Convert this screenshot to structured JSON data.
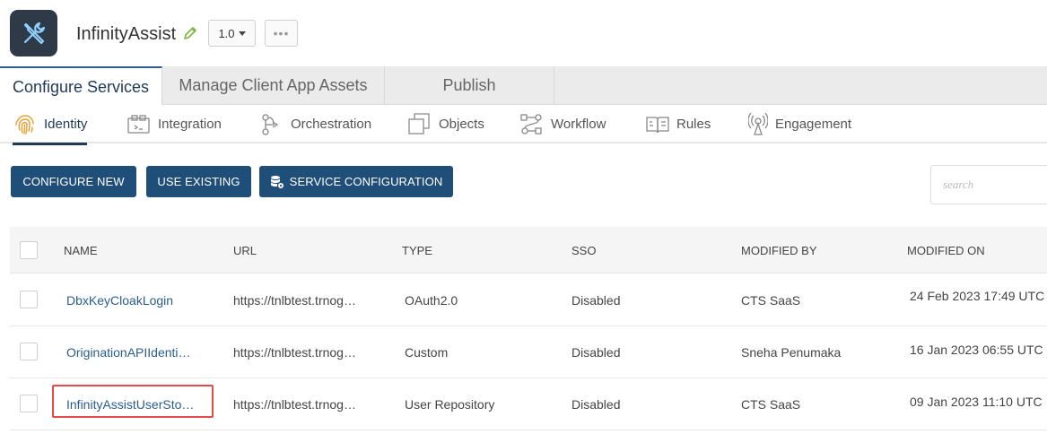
{
  "header": {
    "app_name": "InfinityAssist",
    "version": "1.0",
    "more": "•••"
  },
  "main_tabs": [
    {
      "label": "Configure Services",
      "active": true
    },
    {
      "label": "Manage Client App Assets",
      "active": false
    },
    {
      "label": "Publish",
      "active": false
    }
  ],
  "sub_tabs": [
    {
      "label": "Identity",
      "icon": "fingerprint-icon",
      "active": true
    },
    {
      "label": "Integration",
      "icon": "integration-icon",
      "active": false
    },
    {
      "label": "Orchestration",
      "icon": "orchestration-icon",
      "active": false
    },
    {
      "label": "Objects",
      "icon": "objects-icon",
      "active": false
    },
    {
      "label": "Workflow",
      "icon": "workflow-icon",
      "active": false
    },
    {
      "label": "Rules",
      "icon": "rules-icon",
      "active": false
    },
    {
      "label": "Engagement",
      "icon": "engagement-icon",
      "active": false
    }
  ],
  "actions": {
    "configure_new": "CONFIGURE NEW",
    "use_existing": "USE EXISTING",
    "service_configuration": "SERVICE CONFIGURATION"
  },
  "search": {
    "placeholder": "search"
  },
  "table": {
    "columns": [
      "NAME",
      "URL",
      "TYPE",
      "SSO",
      "MODIFIED BY",
      "MODIFIED ON"
    ],
    "rows": [
      {
        "name": "DbxKeyCloakLogin",
        "url": "https://tnlbtest.trnog…",
        "type": "OAuth2.0",
        "sso": "Disabled",
        "modified_by": "CTS SaaS",
        "modified_on": "24 Feb 2023 17:49 UTC"
      },
      {
        "name": "OriginationAPIIdenti…",
        "url": "https://tnlbtest.trnog…",
        "type": "Custom",
        "sso": "Disabled",
        "modified_by": "Sneha Penumaka",
        "modified_on": "16 Jan 2023 06:55 UTC"
      },
      {
        "name": "InfinityAssistUserSto…",
        "url": "https://tnlbtest.trnog…",
        "type": "User Repository",
        "sso": "Disabled",
        "modified_by": "CTS SaaS",
        "modified_on": "09 Jan 2023 11:10 UTC"
      }
    ]
  },
  "colors": {
    "primary": "#1f4e79",
    "link": "#2a5d8f",
    "highlight": "#e34b4b",
    "logo_bg": "#2e3a48",
    "edit_green": "#7cb342"
  }
}
